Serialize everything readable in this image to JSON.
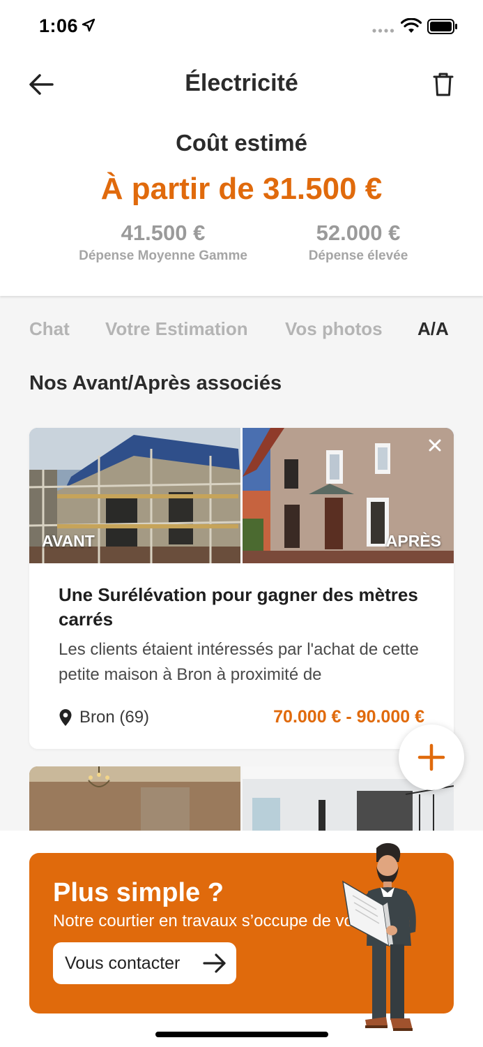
{
  "status_bar": {
    "time": "1:06"
  },
  "header": {
    "title": "Électricité",
    "cost_label": "Coût estimé",
    "cost_main": "À partir de 31.500 €",
    "mid_value": "41.500 €",
    "mid_label": "Dépense Moyenne Gamme",
    "high_value": "52.000 €",
    "high_label": "Dépense élevée"
  },
  "tabs": [
    {
      "label": "Chat",
      "active": false
    },
    {
      "label": "Votre Estimation",
      "active": false
    },
    {
      "label": "Vos photos",
      "active": false
    },
    {
      "label": "A/A",
      "active": true
    }
  ],
  "section_title": "Nos Avant/Après associés",
  "card": {
    "before_label": "AVANT",
    "after_label": "APRÈS",
    "title": "Une Surélévation pour gagner des mètres carrés",
    "description": "Les clients étaient intéressés par l'achat de cette petite maison à Bron à proximité de",
    "location": "Bron (69)",
    "price": "70.000 € - 90.000 €"
  },
  "promo": {
    "title": "Plus simple ?",
    "subtitle": "Notre courtier en travaux s’occupe de vous",
    "button_label": "Vous contacter"
  },
  "colors": {
    "accent": "#e06a0c",
    "text": "#2b2b2b",
    "muted": "#b4b4b4"
  }
}
